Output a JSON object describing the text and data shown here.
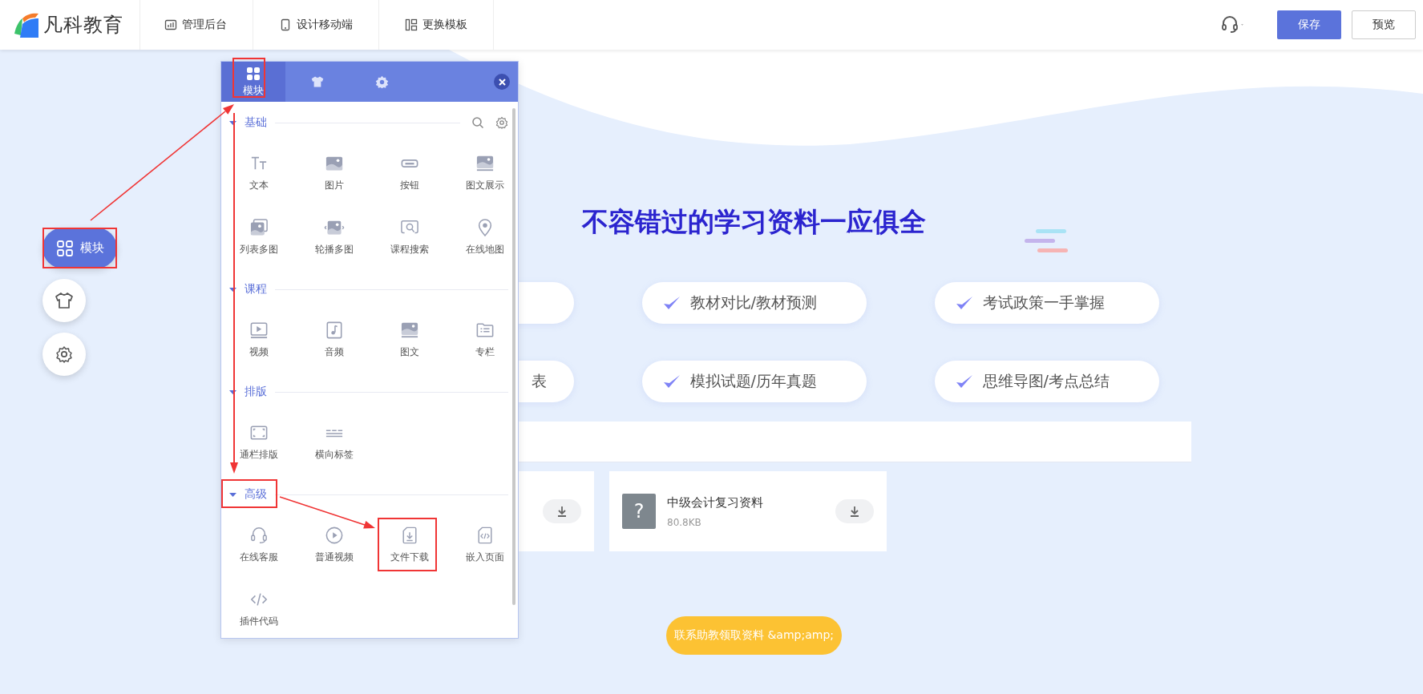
{
  "header": {
    "logo_text": "凡科教育",
    "nav": [
      {
        "kind": "chart",
        "label": "管理后台"
      },
      {
        "kind": "phone",
        "label": "设计移动端"
      },
      {
        "kind": "layout",
        "label": "更换模板"
      }
    ],
    "save_label": "保存",
    "preview_label": "预览"
  },
  "side_dock": [
    {
      "kind": "modules",
      "label": "模块",
      "selected": true
    },
    {
      "kind": "shirt",
      "selected": false
    },
    {
      "kind": "gear",
      "selected": false
    }
  ],
  "panel": {
    "tabs": [
      {
        "kind": "grid",
        "label": "模块",
        "selected": true
      },
      {
        "kind": "shirt",
        "selected": false
      },
      {
        "kind": "gear",
        "selected": false
      }
    ],
    "sections": [
      {
        "title": "基础",
        "expanded": true,
        "tools": true,
        "items": [
          {
            "kind": "text",
            "label": "文本"
          },
          {
            "kind": "image",
            "label": "图片"
          },
          {
            "kind": "button",
            "label": "按钮"
          },
          {
            "kind": "imagetext",
            "label": "图文展示"
          },
          {
            "kind": "list",
            "label": "列表多图"
          },
          {
            "kind": "carousel",
            "label": "轮播多图"
          },
          {
            "kind": "search",
            "label": "课程搜索"
          },
          {
            "kind": "map",
            "label": "在线地图"
          }
        ]
      },
      {
        "title": "课程",
        "expanded": true,
        "tools": false,
        "items": [
          {
            "kind": "video",
            "label": "视频"
          },
          {
            "kind": "audio",
            "label": "音频"
          },
          {
            "kind": "imagetext",
            "label": "图文"
          },
          {
            "kind": "column",
            "label": "专栏"
          }
        ]
      },
      {
        "title": "排版",
        "expanded": true,
        "tools": false,
        "items": [
          {
            "kind": "frame",
            "label": "通栏排版"
          },
          {
            "kind": "tabs",
            "label": "横向标签"
          }
        ]
      },
      {
        "title": "高级",
        "expanded": true,
        "tools": false,
        "items": [
          {
            "kind": "headset",
            "label": "在线客服"
          },
          {
            "kind": "play",
            "label": "普通视频"
          },
          {
            "kind": "download",
            "label": "文件下载"
          },
          {
            "kind": "embed",
            "label": "嵌入页面"
          },
          {
            "kind": "code",
            "label": "插件代码"
          }
        ]
      }
    ]
  },
  "content": {
    "title": "不容错过的学习资料一应俱全",
    "features": [
      {
        "check": false
      },
      {
        "check": true,
        "text": "教材对比/教材预测"
      },
      {
        "check": true,
        "text": "考试政策一手掌握"
      },
      {
        "check": false,
        "text": "表"
      },
      {
        "check": true,
        "text": "模拟试题/历年真题"
      },
      {
        "check": true,
        "text": "思维导图/考点总结"
      }
    ],
    "files": [
      {
        "download": true
      },
      {
        "download": true,
        "name": "中级会计复习资料",
        "size": "80.8KB",
        "icon_text": "?"
      }
    ],
    "contact_label": "联系助教领取资料 &amp;amp;"
  }
}
